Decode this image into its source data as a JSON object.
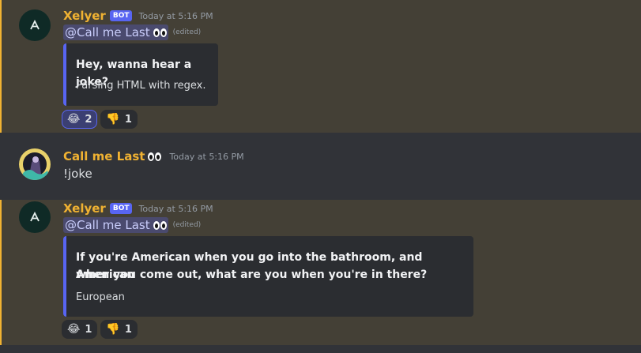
{
  "messages": [
    {
      "author": "Xelyer",
      "bot_tag": "BOT",
      "timestamp": "Today at 5:16 PM",
      "mention": "@Call me Last",
      "edited": "(edited)",
      "embed": {
        "title": "Hey, wanna hear a joke?",
        "description": "Parsing HTML with regex.",
        "accent_color": "#5865f2"
      },
      "reactions": [
        {
          "emoji": "😂",
          "count": "2",
          "icon": "tears-of-joy-icon"
        },
        {
          "emoji": "👎",
          "count": "1",
          "icon": "thumbs-down-icon"
        }
      ]
    },
    {
      "author": "Call me Last",
      "timestamp": "Today at 5:16 PM",
      "text": "!joke"
    },
    {
      "author": "Xelyer",
      "bot_tag": "BOT",
      "timestamp": "Today at 5:16 PM",
      "mention": "@Call me Last",
      "edited": "(edited)",
      "embed": {
        "title_line1": "If you're American when you go into the bathroom, and American",
        "title_line2": "when you come out, what are you when you're in there?",
        "description": "European",
        "accent_color": "#5865f2"
      },
      "reactions": [
        {
          "emoji": "😂",
          "count": "1",
          "icon": "tears-of-joy-icon"
        },
        {
          "emoji": "👎",
          "count": "1",
          "icon": "thumbs-down-icon"
        }
      ]
    }
  ],
  "colors": {
    "highlight_bg": "#444036",
    "highlight_bar": "#f0b232",
    "username": "#f0b232",
    "bot_tag": "#5865f2"
  }
}
